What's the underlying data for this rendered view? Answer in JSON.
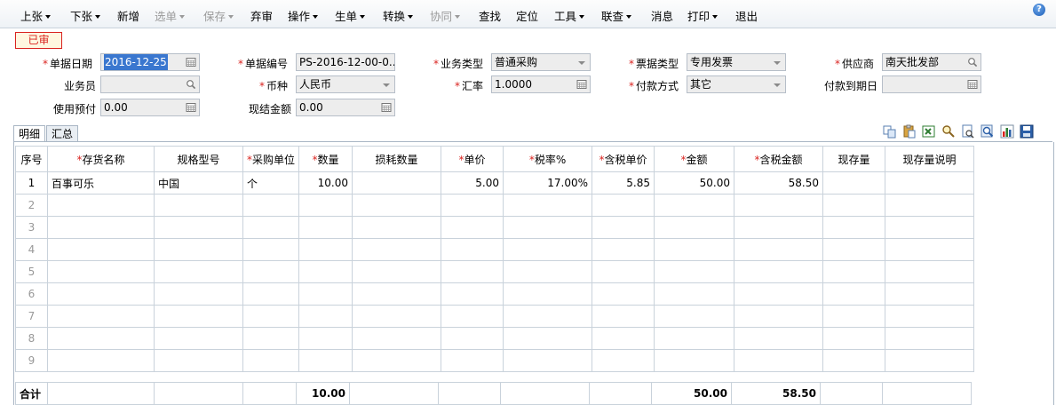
{
  "toolbar": {
    "items": [
      {
        "label": "上张",
        "dropdown": true,
        "disabled": false
      },
      {
        "label": "下张",
        "dropdown": true,
        "disabled": false
      },
      {
        "label": "新增",
        "dropdown": false,
        "disabled": false
      },
      {
        "label": "选单",
        "dropdown": true,
        "disabled": true
      },
      {
        "label": "保存",
        "dropdown": true,
        "disabled": true
      },
      {
        "label": "弃审",
        "dropdown": false,
        "disabled": false
      },
      {
        "label": "操作",
        "dropdown": true,
        "disabled": false
      },
      {
        "label": "生单",
        "dropdown": true,
        "disabled": false
      },
      {
        "label": "转换",
        "dropdown": true,
        "disabled": false
      },
      {
        "label": "协同",
        "dropdown": true,
        "disabled": true
      },
      {
        "label": "查找",
        "dropdown": false,
        "disabled": false
      },
      {
        "label": "定位",
        "dropdown": false,
        "disabled": false
      },
      {
        "label": "工具",
        "dropdown": true,
        "disabled": false
      },
      {
        "label": "联查",
        "dropdown": true,
        "disabled": false
      },
      {
        "label": "消息",
        "dropdown": false,
        "disabled": false
      },
      {
        "label": "打印",
        "dropdown": true,
        "disabled": false
      },
      {
        "label": "退出",
        "dropdown": false,
        "disabled": false
      }
    ],
    "help_icon": "help-icon"
  },
  "status_badge": "已审",
  "form": {
    "date_label": "单据日期",
    "date_value": "2016-12-25",
    "doc_no_label": "单据编号",
    "doc_no_value": "PS-2016-12-00-0...",
    "biz_type_label": "业务类型",
    "biz_type_value": "普通采购",
    "invoice_type_label": "票据类型",
    "invoice_type_value": "专用发票",
    "supplier_label": "供应商",
    "supplier_value": "南天批发部",
    "salesman_label": "业务员",
    "salesman_value": "",
    "currency_label": "币种",
    "currency_value": "人民币",
    "rate_label": "汇率",
    "rate_value": "1.0000",
    "pay_method_label": "付款方式",
    "pay_method_value": "其它",
    "pay_due_label": "付款到期日",
    "pay_due_value": "",
    "prepay_label": "使用预付",
    "prepay_value": "0.00",
    "settle_label": "现结金额",
    "settle_value": "0.00"
  },
  "tabs": [
    "明细",
    "汇总"
  ],
  "grid_tool_icons": [
    "copy-icon",
    "paste-icon",
    "excel-export-icon",
    "search-filter-icon",
    "preview-icon",
    "zoom-icon",
    "chart-icon",
    "save-layout-icon"
  ],
  "grid": {
    "columns": [
      "序号",
      "存货名称",
      "规格型号",
      "采购单位",
      "数量",
      "损耗数量",
      "单价",
      "税率%",
      "含税单价",
      "金额",
      "含税金额",
      "现存量",
      "现存量说明"
    ],
    "rows": [
      [
        "1",
        "百事可乐",
        "中国",
        "个",
        "10.00",
        "",
        "5.00",
        "17.00%",
        "5.85",
        "50.00",
        "58.50",
        "",
        ""
      ],
      [
        "2",
        "",
        "",
        "",
        "",
        "",
        "",
        "",
        "",
        "",
        "",
        "",
        ""
      ],
      [
        "3",
        "",
        "",
        "",
        "",
        "",
        "",
        "",
        "",
        "",
        "",
        "",
        ""
      ],
      [
        "4",
        "",
        "",
        "",
        "",
        "",
        "",
        "",
        "",
        "",
        "",
        "",
        ""
      ],
      [
        "5",
        "",
        "",
        "",
        "",
        "",
        "",
        "",
        "",
        "",
        "",
        "",
        ""
      ],
      [
        "6",
        "",
        "",
        "",
        "",
        "",
        "",
        "",
        "",
        "",
        "",
        "",
        ""
      ],
      [
        "7",
        "",
        "",
        "",
        "",
        "",
        "",
        "",
        "",
        "",
        "",
        "",
        ""
      ],
      [
        "8",
        "",
        "",
        "",
        "",
        "",
        "",
        "",
        "",
        "",
        "",
        "",
        ""
      ],
      [
        "9",
        "",
        "",
        "",
        "",
        "",
        "",
        "",
        "",
        "",
        "",
        "",
        ""
      ]
    ],
    "totals": {
      "label": "合计",
      "quantity": "10.00",
      "amount": "50.00",
      "amount_with_tax": "58.50"
    }
  },
  "colors": {
    "accent_red": "#d9231f",
    "selection_blue": "#3a77cf"
  }
}
